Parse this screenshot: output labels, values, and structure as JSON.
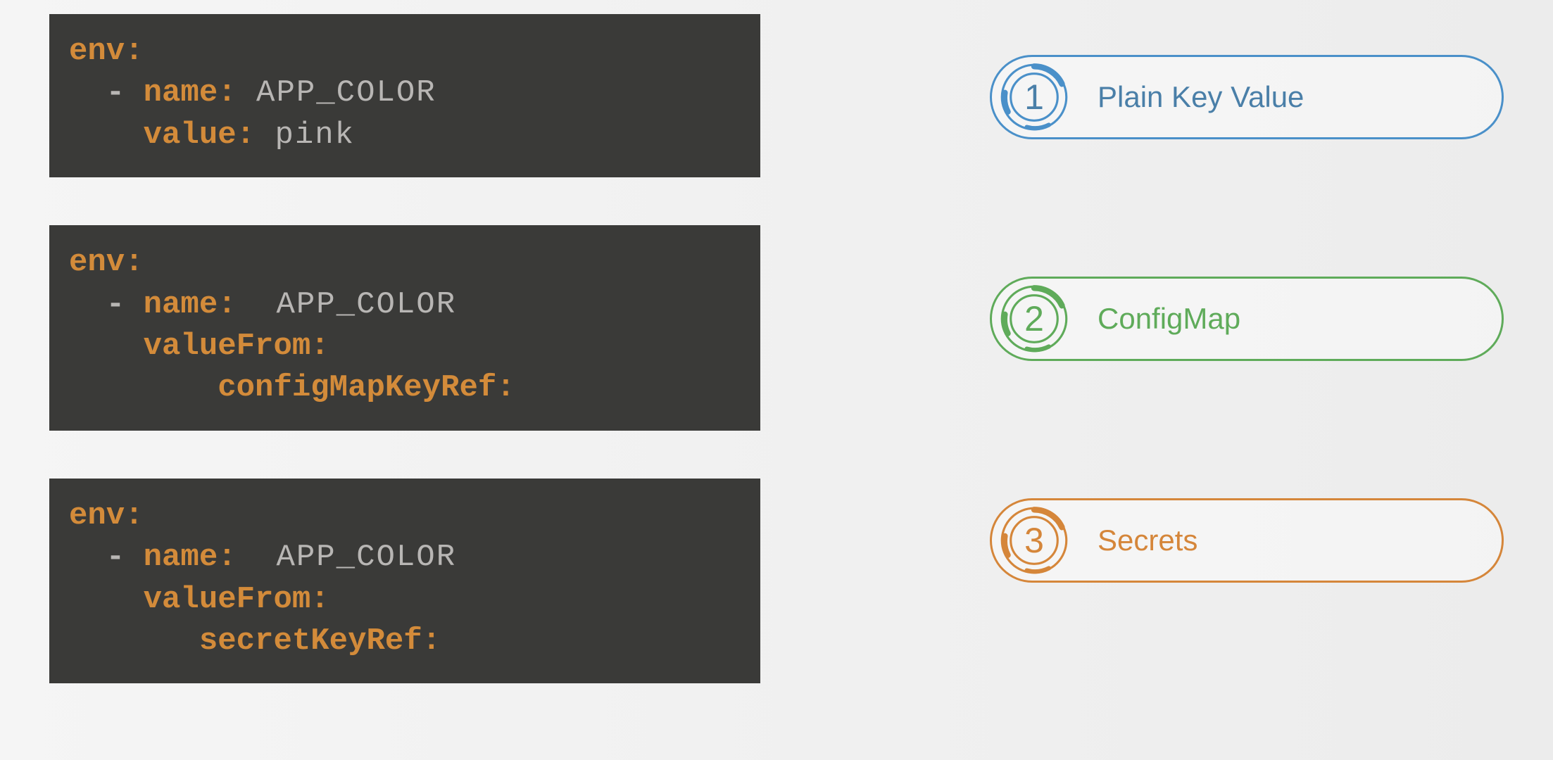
{
  "codeBlocks": {
    "block1": {
      "env": "env:",
      "dash": "  - ",
      "nameKey": "name:",
      "nameVal": " APP_COLOR",
      "valueKey": "    value:",
      "valueVal": " pink"
    },
    "block2": {
      "env": "env:",
      "dash": "  - ",
      "nameKey": "name:",
      "nameVal": "  APP_COLOR",
      "valueFrom": "    valueFrom:",
      "refKey": "        configMapKeyRef:"
    },
    "block3": {
      "env": "env:",
      "dash": "  - ",
      "nameKey": "name:",
      "nameVal": "  APP_COLOR",
      "valueFrom": "    valueFrom:",
      "refKey": "       secretKeyRef:"
    }
  },
  "pills": [
    {
      "num": "1",
      "label": "Plain Key Value",
      "color": "blue"
    },
    {
      "num": "2",
      "label": "ConfigMap",
      "color": "green"
    },
    {
      "num": "3",
      "label": "Secrets",
      "color": "orange"
    }
  ],
  "colors": {
    "blue": "#4a90c9",
    "green": "#5fab5a",
    "orange": "#d5863a"
  }
}
